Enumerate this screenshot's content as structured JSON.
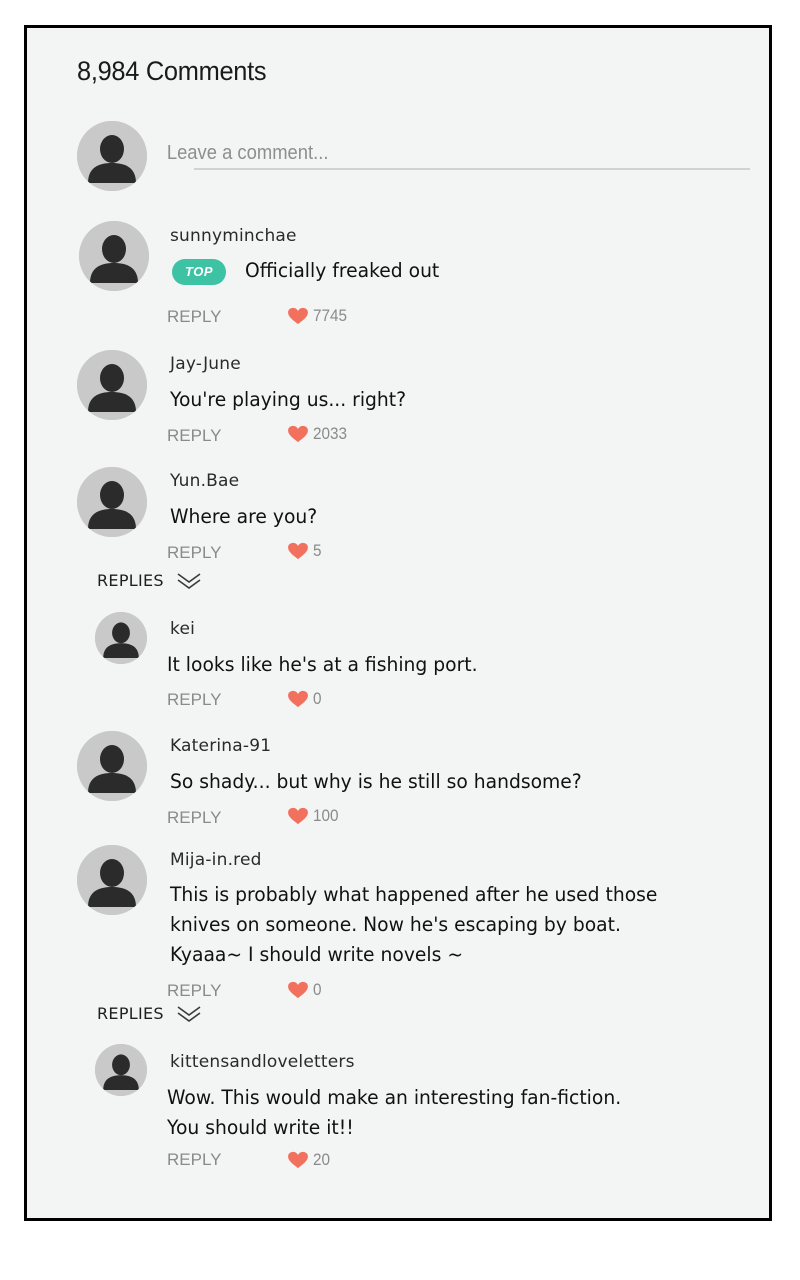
{
  "header": {
    "comment_count_title": "8,984 Comments"
  },
  "composer": {
    "placeholder": "Leave a comment..."
  },
  "reply_label": "REPLY",
  "top_badge_label": "TOP",
  "replies_label": "REPLIES",
  "colors": {
    "accent_top": "#3dc3a4",
    "heart": "#f2705e",
    "avatar_bg": "#c9c9c9",
    "avatar_fg": "#2b2b2b"
  },
  "icons": {
    "avatar": "person-silhouette-icon",
    "like": "heart-icon",
    "expand": "double-chevron-down-icon"
  },
  "comments": [
    {
      "username": "sunnyminchae",
      "badge": "TOP",
      "text": [
        "Officially freaked out"
      ],
      "likes": "7745"
    },
    {
      "username": "Jay-June",
      "text": [
        "You're playing us... right?"
      ],
      "likes": "2033"
    },
    {
      "username": "Yun.Bae",
      "text": [
        "Where are you?"
      ],
      "likes": "5"
    },
    {
      "username": "kei",
      "is_reply": true,
      "text": [
        "It looks like he's at a fishing port."
      ],
      "likes": "0"
    },
    {
      "username": "Katerina-91",
      "text": [
        "So shady... but why is he still so handsome?"
      ],
      "likes": "100"
    },
    {
      "username": "Mija-in.red",
      "text": [
        "This is probably what happened after he used those",
        "knives on someone. Now he's escaping by boat.",
        "Kyaaa~ I should write novels ~"
      ],
      "likes": "0"
    },
    {
      "username": "kittensandloveletters",
      "is_reply": true,
      "text": [
        "Wow. This would make an interesting fan-fiction.",
        "You should write it!!"
      ],
      "likes": "20"
    }
  ]
}
